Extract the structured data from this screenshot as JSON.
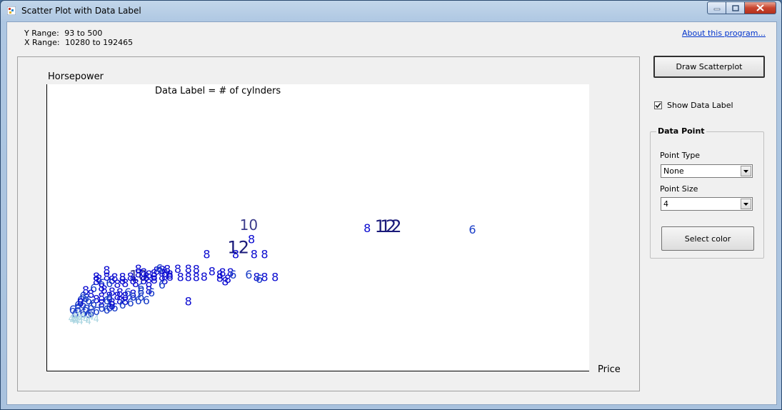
{
  "window": {
    "title": "Scatter Plot with Data Label"
  },
  "info": {
    "y_range_label": "Y Range:",
    "y_range_value": "93 to 500",
    "x_range_label": "X Range:",
    "x_range_value": "10280 to 192465",
    "about_link": "About this program..."
  },
  "controls": {
    "draw_button": "Draw Scatterplot",
    "show_data_label": "Show Data Label",
    "show_data_label_checked": true,
    "group_title": "Data Point",
    "point_type_label": "Point Type",
    "point_type_value": "None",
    "point_size_label": "Point Size",
    "point_size_value": "4",
    "select_color_button": "Select color"
  },
  "chart_data": {
    "type": "scatter",
    "ylabel": "Horsepower",
    "xlabel": "Price",
    "annotation": "Data Label = # of cylnders",
    "xlim": [
      10280,
      192465
    ],
    "ylim": [
      93,
      500
    ],
    "label_colors": {
      "4": "#a8d4e0",
      "6": "#1a3ec8",
      "8": "#0a0ad0",
      "10": "#3a3a8a",
      "12": "#1a1a7a"
    },
    "points": [
      {
        "x": 163000,
        "y": 305,
        "label": "6"
      },
      {
        "x": 132000,
        "y": 308,
        "label": "12"
      },
      {
        "x": 130000,
        "y": 308,
        "label": "12"
      },
      {
        "x": 123000,
        "y": 308,
        "label": "8"
      },
      {
        "x": 78000,
        "y": 313,
        "label": "10"
      },
      {
        "x": 79000,
        "y": 282,
        "label": "8"
      },
      {
        "x": 74000,
        "y": 259,
        "label": "12"
      },
      {
        "x": 73000,
        "y": 247,
        "label": "8"
      },
      {
        "x": 80000,
        "y": 247,
        "label": "8"
      },
      {
        "x": 84000,
        "y": 247,
        "label": "8"
      },
      {
        "x": 62000,
        "y": 247,
        "label": "8"
      },
      {
        "x": 45000,
        "y": 211,
        "label": "8"
      },
      {
        "x": 51000,
        "y": 213,
        "label": "8"
      },
      {
        "x": 55000,
        "y": 213,
        "label": "8"
      },
      {
        "x": 58000,
        "y": 212,
        "label": "8"
      },
      {
        "x": 64000,
        "y": 207,
        "label": "8"
      },
      {
        "x": 68000,
        "y": 205,
        "label": "8"
      },
      {
        "x": 71000,
        "y": 205,
        "label": "8"
      },
      {
        "x": 67000,
        "y": 200,
        "label": "8"
      },
      {
        "x": 72000,
        "y": 200,
        "label": "6"
      },
      {
        "x": 78000,
        "y": 200,
        "label": "6"
      },
      {
        "x": 81000,
        "y": 194,
        "label": "8"
      },
      {
        "x": 84000,
        "y": 194,
        "label": "8"
      },
      {
        "x": 88000,
        "y": 194,
        "label": "8"
      },
      {
        "x": 82000,
        "y": 190,
        "label": "6"
      },
      {
        "x": 67000,
        "y": 192,
        "label": "8"
      },
      {
        "x": 70000,
        "y": 190,
        "label": "8"
      },
      {
        "x": 69000,
        "y": 184,
        "label": "8"
      },
      {
        "x": 58000,
        "y": 194,
        "label": "8"
      },
      {
        "x": 61000,
        "y": 195,
        "label": "8"
      },
      {
        "x": 55000,
        "y": 194,
        "label": "8"
      },
      {
        "x": 52000,
        "y": 194,
        "label": "8"
      },
      {
        "x": 48000,
        "y": 195,
        "label": "8"
      },
      {
        "x": 45000,
        "y": 195,
        "label": "8"
      },
      {
        "x": 42000,
        "y": 195,
        "label": "8"
      },
      {
        "x": 39000,
        "y": 195,
        "label": "8"
      },
      {
        "x": 36000,
        "y": 195,
        "label": "10"
      },
      {
        "x": 33000,
        "y": 195,
        "label": "8"
      },
      {
        "x": 30000,
        "y": 194,
        "label": "8"
      },
      {
        "x": 27000,
        "y": 193,
        "label": "8"
      },
      {
        "x": 24000,
        "y": 195,
        "label": "8"
      },
      {
        "x": 20000,
        "y": 195,
        "label": "8"
      },
      {
        "x": 21000,
        "y": 190,
        "label": "8"
      },
      {
        "x": 26000,
        "y": 187,
        "label": "8"
      },
      {
        "x": 30000,
        "y": 186,
        "label": "8"
      },
      {
        "x": 34000,
        "y": 186,
        "label": "8"
      },
      {
        "x": 38000,
        "y": 186,
        "label": "8"
      },
      {
        "x": 42000,
        "y": 188,
        "label": "8"
      },
      {
        "x": 46000,
        "y": 186,
        "label": "8"
      },
      {
        "x": 43000,
        "y": 209,
        "label": "8"
      },
      {
        "x": 42000,
        "y": 202,
        "label": "8"
      },
      {
        "x": 46000,
        "y": 203,
        "label": "8"
      },
      {
        "x": 48000,
        "y": 200,
        "label": "8"
      },
      {
        "x": 40000,
        "y": 200,
        "label": "8"
      },
      {
        "x": 36000,
        "y": 202,
        "label": "8"
      },
      {
        "x": 38000,
        "y": 205,
        "label": "8"
      },
      {
        "x": 44000,
        "y": 214,
        "label": "6"
      },
      {
        "x": 47000,
        "y": 212,
        "label": "8"
      },
      {
        "x": 36000,
        "y": 213,
        "label": "8"
      },
      {
        "x": 24000,
        "y": 210,
        "label": "8"
      },
      {
        "x": 20000,
        "y": 185,
        "label": "8"
      },
      {
        "x": 22000,
        "y": 180,
        "label": "6"
      },
      {
        "x": 25000,
        "y": 180,
        "label": "6"
      },
      {
        "x": 28000,
        "y": 178,
        "label": "8"
      },
      {
        "x": 31000,
        "y": 180,
        "label": "8"
      },
      {
        "x": 35000,
        "y": 180,
        "label": "8"
      },
      {
        "x": 40000,
        "y": 180,
        "label": "8"
      },
      {
        "x": 45000,
        "y": 176,
        "label": "6"
      },
      {
        "x": 37000,
        "y": 170,
        "label": "6"
      },
      {
        "x": 40000,
        "y": 163,
        "label": "8"
      },
      {
        "x": 37000,
        "y": 160,
        "label": "6"
      },
      {
        "x": 41000,
        "y": 158,
        "label": "6"
      },
      {
        "x": 34000,
        "y": 155,
        "label": "8"
      },
      {
        "x": 32000,
        "y": 158,
        "label": "6"
      },
      {
        "x": 29000,
        "y": 158,
        "label": "8"
      },
      {
        "x": 26000,
        "y": 160,
        "label": "8"
      },
      {
        "x": 23000,
        "y": 165,
        "label": "8"
      },
      {
        "x": 19000,
        "y": 168,
        "label": "6"
      },
      {
        "x": 22000,
        "y": 170,
        "label": "8"
      },
      {
        "x": 16000,
        "y": 163,
        "label": "8"
      },
      {
        "x": 18000,
        "y": 155,
        "label": "8"
      },
      {
        "x": 15000,
        "y": 150,
        "label": "6"
      },
      {
        "x": 16000,
        "y": 145,
        "label": "6"
      },
      {
        "x": 14000,
        "y": 140,
        "label": "6"
      },
      {
        "x": 17000,
        "y": 140,
        "label": "6"
      },
      {
        "x": 20000,
        "y": 142,
        "label": "8"
      },
      {
        "x": 22000,
        "y": 148,
        "label": "8"
      },
      {
        "x": 25000,
        "y": 150,
        "label": "8"
      },
      {
        "x": 28000,
        "y": 150,
        "label": "8"
      },
      {
        "x": 31000,
        "y": 150,
        "label": "8"
      },
      {
        "x": 34000,
        "y": 148,
        "label": "6"
      },
      {
        "x": 37000,
        "y": 148,
        "label": "6"
      },
      {
        "x": 24000,
        "y": 140,
        "label": "6"
      },
      {
        "x": 26000,
        "y": 135,
        "label": "8"
      },
      {
        "x": 22000,
        "y": 132,
        "label": "8"
      },
      {
        "x": 19000,
        "y": 132,
        "label": "6"
      },
      {
        "x": 15000,
        "y": 130,
        "label": "6"
      },
      {
        "x": 13000,
        "y": 128,
        "label": "6"
      },
      {
        "x": 14000,
        "y": 135,
        "label": "8"
      },
      {
        "x": 18000,
        "y": 125,
        "label": "6"
      },
      {
        "x": 22000,
        "y": 122,
        "label": "6"
      },
      {
        "x": 16000,
        "y": 120,
        "label": "6"
      },
      {
        "x": 13000,
        "y": 120,
        "label": "6"
      },
      {
        "x": 11000,
        "y": 118,
        "label": "6"
      },
      {
        "x": 15000,
        "y": 110,
        "label": "6"
      },
      {
        "x": 17000,
        "y": 108,
        "label": "6"
      },
      {
        "x": 25000,
        "y": 123,
        "label": "6"
      },
      {
        "x": 27000,
        "y": 123,
        "label": "6"
      },
      {
        "x": 25000,
        "y": 145,
        "label": "6"
      },
      {
        "x": 29000,
        "y": 140,
        "label": "8"
      },
      {
        "x": 31000,
        "y": 138,
        "label": "8"
      },
      {
        "x": 26000,
        "y": 128,
        "label": "8"
      },
      {
        "x": 30000,
        "y": 130,
        "label": "6"
      },
      {
        "x": 33000,
        "y": 135,
        "label": "6"
      },
      {
        "x": 36000,
        "y": 140,
        "label": "6"
      },
      {
        "x": 39000,
        "y": 140,
        "label": "6"
      },
      {
        "x": 55000,
        "y": 137,
        "label": "8"
      },
      {
        "x": 20000,
        "y": 115,
        "label": "6"
      },
      {
        "x": 24000,
        "y": 118,
        "label": "6"
      },
      {
        "x": 18000,
        "y": 110,
        "label": "6"
      },
      {
        "x": 12000,
        "y": 108,
        "label": "6"
      },
      {
        "x": 14000,
        "y": 100,
        "label": "4"
      },
      {
        "x": 12000,
        "y": 97,
        "label": "4"
      },
      {
        "x": 10500,
        "y": 99,
        "label": "4"
      },
      {
        "x": 15000,
        "y": 105,
        "label": "4"
      },
      {
        "x": 13000,
        "y": 106,
        "label": "4"
      },
      {
        "x": 11000,
        "y": 95,
        "label": "4"
      },
      {
        "x": 12500,
        "y": 93,
        "label": "4"
      },
      {
        "x": 16000,
        "y": 97,
        "label": "4"
      },
      {
        "x": 17000,
        "y": 93,
        "label": "4"
      },
      {
        "x": 18000,
        "y": 103,
        "label": "4"
      },
      {
        "x": 20000,
        "y": 98,
        "label": "4"
      },
      {
        "x": 14000,
        "y": 93,
        "label": "4"
      },
      {
        "x": 11500,
        "y": 104,
        "label": "4"
      }
    ]
  }
}
